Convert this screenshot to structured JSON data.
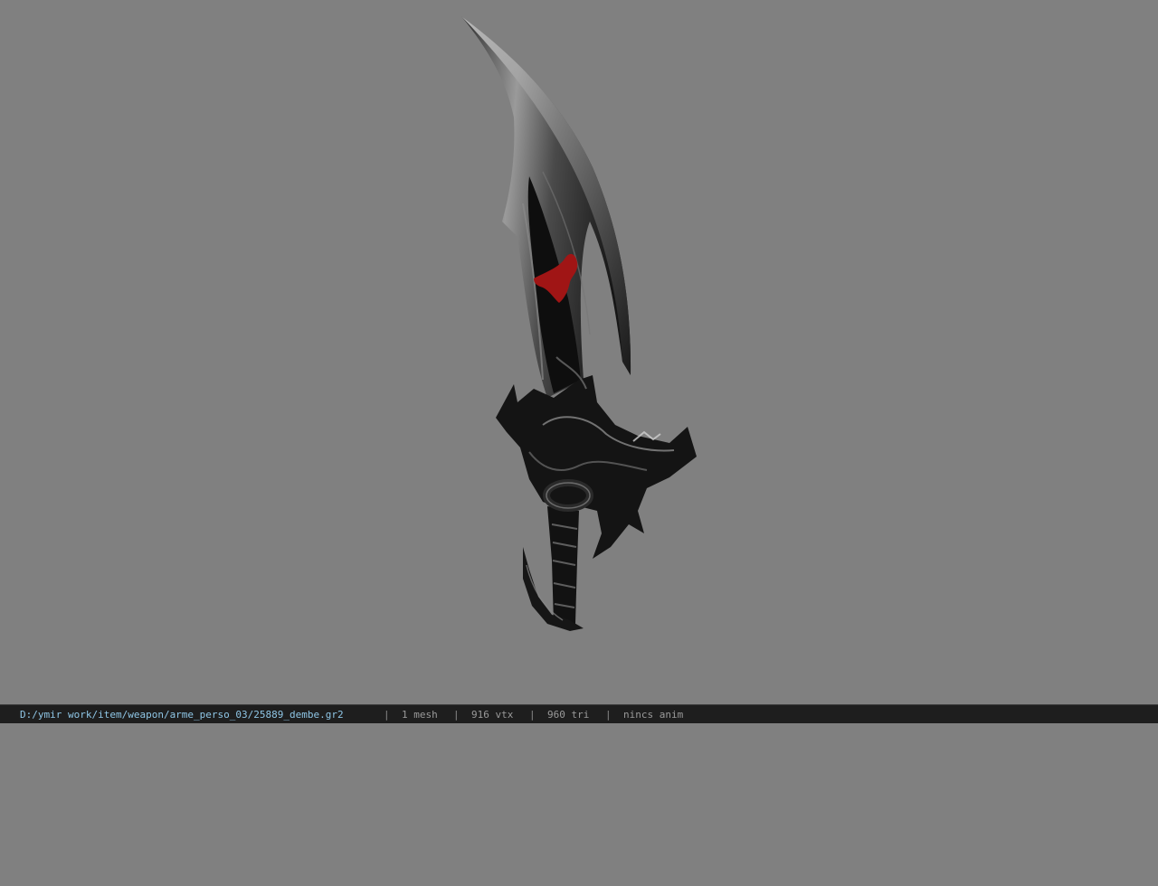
{
  "viewport": {
    "background_color": "#808080",
    "model_name": "sword-model"
  },
  "statusbar": {
    "file_path": "D:/ymir work/item/weapon/arme_perso_03/25889_dembe.gr2",
    "separator": "|",
    "mesh_count": "1 mesh",
    "vertex_count": "916 vtx",
    "triangle_count": "960 tri",
    "anim_status": "nincs anim",
    "path_color": "#8fc6e6",
    "text_color": "#9a9a9a"
  }
}
